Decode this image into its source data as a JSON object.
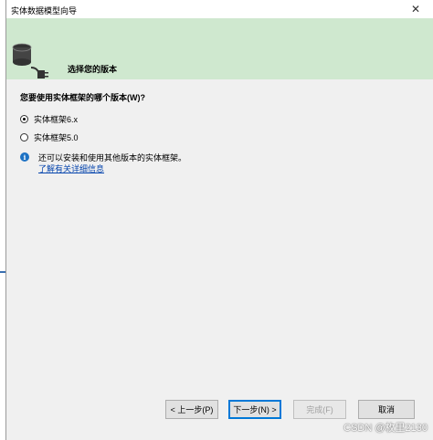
{
  "window": {
    "title": "实体数据模型向导",
    "close_symbol": "✕"
  },
  "banner": {
    "title": "选择您的版本",
    "background": "#cfe8cf",
    "icon": "database-plug-icon"
  },
  "form": {
    "question": "您要使用实体框架的哪个版本(W)?",
    "options": [
      {
        "label": "实体框架6.x",
        "selected": true
      },
      {
        "label": "实体框架5.0",
        "selected": false
      }
    ],
    "info_text": "还可以安装和使用其他版本的实体框架。",
    "info_link": "了解有关详细信息",
    "info_icon": "info-icon"
  },
  "buttons": {
    "back": "< 上一步(P)",
    "next": "下一步(N) >",
    "finish": "完成(F)",
    "cancel": "取消"
  },
  "watermark": "CSDN @枚里2130",
  "colors": {
    "accent": "#0078d7",
    "link": "#0645ad",
    "info": "#1e72c4"
  }
}
